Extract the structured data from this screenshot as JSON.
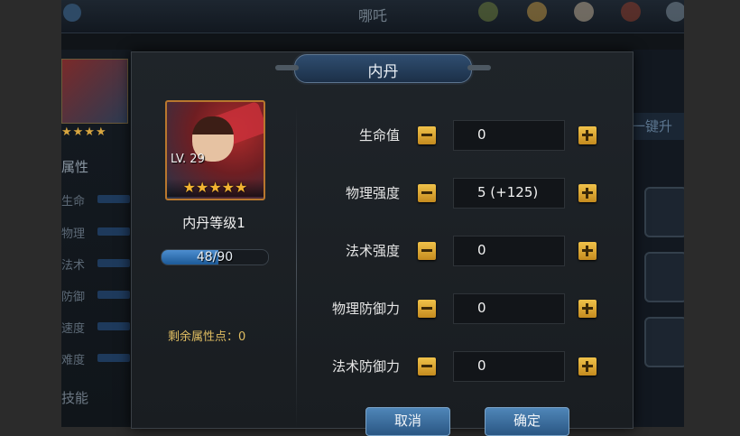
{
  "background": {
    "title": "哪吒",
    "top_icons": [
      "leaf-icon",
      "coin-icon",
      "scroll-icon",
      "chest-icon",
      "sword-icon"
    ],
    "left_stars": "★★★★",
    "attr_title": "属性",
    "attr_labels": [
      "生命",
      "物理",
      "法术",
      "防御",
      "速度",
      "难度"
    ],
    "skill_title": "技能",
    "one_key_label": "一键升"
  },
  "dialog": {
    "title": "内丹",
    "hero": {
      "level": "LV. 29",
      "stars": 5
    },
    "core_level": "内丹等级1",
    "xp": {
      "text": "48/90",
      "current": 48,
      "max": 90
    },
    "points_label": "剩余属性点：0",
    "attributes": [
      {
        "label": "生命值",
        "value": "0"
      },
      {
        "label": "物理强度",
        "value": "5 (+125)"
      },
      {
        "label": "法术强度",
        "value": "0"
      },
      {
        "label": "物理防御力",
        "value": "0"
      },
      {
        "label": "法术防御力",
        "value": "0"
      }
    ],
    "cancel_label": "取消",
    "confirm_label": "确定"
  },
  "colors": {
    "accent_gold": "#e0a22c",
    "button_blue": "#3b6fa0",
    "xp_blue": "#3a7ec2"
  }
}
